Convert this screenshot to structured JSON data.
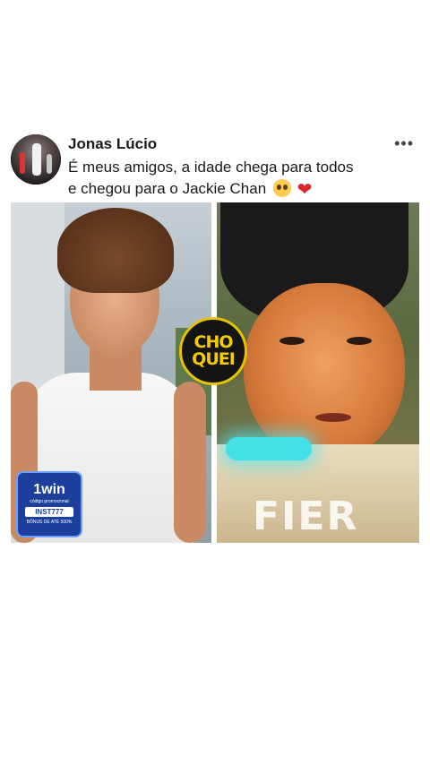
{
  "post": {
    "author_name": "Jonas Lúcio",
    "text_line1": "É meus amigos, a idade chega para todos",
    "text_line2": "e chegou para o Jackie Chan",
    "more_label": "•••"
  },
  "images": {
    "choquei_line1": "CHO",
    "choquei_line2": "QUEI",
    "badge": {
      "logo": "1win",
      "caption": "código promocional",
      "code": "INST777",
      "bonus": "BÔNUS DE ATÉ 500%"
    },
    "watermark": "FIER"
  },
  "colors": {
    "choquei_yellow": "#f2cc00",
    "badge_blue": "#1c3f9c",
    "heart_red": "#e0242f"
  },
  "icons": [
    "more-options-icon",
    "pleading-face-emoji-icon",
    "red-heart-icon"
  ]
}
